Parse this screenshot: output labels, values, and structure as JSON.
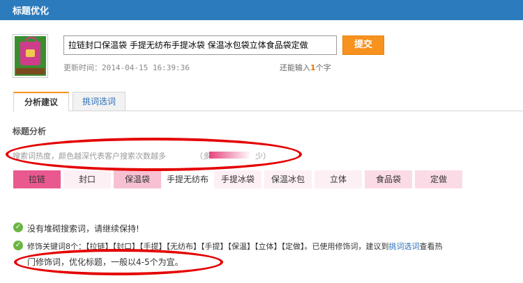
{
  "window": {
    "title": "标题优化"
  },
  "product": {
    "title_value": "拉链封口保温袋 手提无纺布手提冰袋 保温冰包袋立体食品袋定做",
    "submit_label": "提交",
    "updated_label": "更新时间：",
    "updated_value": "2014-04-15 16:39:36",
    "remain_prefix": "还能输入",
    "remain_count": "1",
    "remain_suffix": "个字"
  },
  "tabs": [
    {
      "label": "分析建议",
      "active": true
    },
    {
      "label": "挑词选词",
      "active": false
    }
  ],
  "analysis": {
    "section_title": "标题分析",
    "heat_hint": "搜索词热度，颜色越深代表客户搜索次数越多",
    "legend_more": "（多",
    "legend_less": "少）",
    "keywords": [
      {
        "text": "拉链",
        "color": "#e9598f"
      },
      {
        "text": "封口",
        "color": "#fdf0f4"
      },
      {
        "text": "保温袋",
        "color": "#f7c1d3"
      },
      {
        "text": "手提无纺布",
        "color": "#ffffff"
      },
      {
        "text": "手提冰袋",
        "color": "#fdf0f4"
      },
      {
        "text": "保温冰包",
        "color": "#fdf0f4"
      },
      {
        "text": "立体",
        "color": "#fdf0f4"
      },
      {
        "text": "食品袋",
        "color": "#fbdbe6"
      },
      {
        "text": "定做",
        "color": "#fbdbe6"
      }
    ]
  },
  "results": {
    "line1": "没有堆砌搜索词，请继续保持!",
    "line2_prefix": "修饰关键词8个：【拉链】【封口】【手提】【无纺布】【手提】【保温】【立体】【定做】。已使用修饰词，建议到",
    "line2_link": "挑词选词",
    "line2_suffix": "查看热",
    "line3": "门修饰词，优化标题，一般以4-5个为宜。"
  },
  "colors": {
    "titlebar": "#2c7bbd",
    "accent": "#f7921e",
    "link": "#2a6fb8",
    "annotation": "#e40000"
  }
}
